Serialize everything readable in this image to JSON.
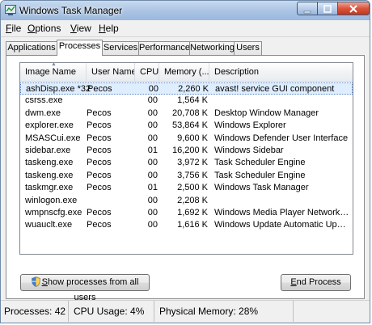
{
  "window": {
    "title": "Windows Task Manager"
  },
  "menu": [
    {
      "label": "File",
      "key": "F",
      "rest": "ile"
    },
    {
      "label": "Options",
      "key": "O",
      "rest": "ptions"
    },
    {
      "label": "View",
      "key": "V",
      "rest": "iew"
    },
    {
      "label": "Help",
      "key": "H",
      "rest": "elp"
    }
  ],
  "tabs": [
    "Applications",
    "Processes",
    "Services",
    "Performance",
    "Networking",
    "Users"
  ],
  "active_tab": "Processes",
  "columns": [
    "Image Name",
    "User Name",
    "CPU",
    "Memory (...",
    "Description"
  ],
  "rows": [
    {
      "name": "ashDisp.exe *32",
      "user": "Pecos",
      "cpu": "00",
      "mem": "2,260 K",
      "desc": "avast! service GUI component",
      "selected": true
    },
    {
      "name": "csrss.exe",
      "user": "",
      "cpu": "00",
      "mem": "1,564 K",
      "desc": ""
    },
    {
      "name": "dwm.exe",
      "user": "Pecos",
      "cpu": "00",
      "mem": "20,708 K",
      "desc": "Desktop Window Manager"
    },
    {
      "name": "explorer.exe",
      "user": "Pecos",
      "cpu": "00",
      "mem": "53,864 K",
      "desc": "Windows Explorer"
    },
    {
      "name": "MSASCui.exe",
      "user": "Pecos",
      "cpu": "00",
      "mem": "9,600 K",
      "desc": "Windows Defender User Interface"
    },
    {
      "name": "sidebar.exe",
      "user": "Pecos",
      "cpu": "01",
      "mem": "16,200 K",
      "desc": "Windows Sidebar"
    },
    {
      "name": "taskeng.exe",
      "user": "Pecos",
      "cpu": "00",
      "mem": "3,972 K",
      "desc": "Task Scheduler Engine"
    },
    {
      "name": "taskeng.exe",
      "user": "Pecos",
      "cpu": "00",
      "mem": "3,756 K",
      "desc": "Task Scheduler Engine"
    },
    {
      "name": "taskmgr.exe",
      "user": "Pecos",
      "cpu": "01",
      "mem": "2,500 K",
      "desc": "Windows Task Manager"
    },
    {
      "name": "winlogon.exe",
      "user": "",
      "cpu": "00",
      "mem": "2,208 K",
      "desc": ""
    },
    {
      "name": "wmpnscfg.exe",
      "user": "Pecos",
      "cpu": "00",
      "mem": "1,692 K",
      "desc": "Windows Media Player Network Shari..."
    },
    {
      "name": "wuauclt.exe",
      "user": "Pecos",
      "cpu": "00",
      "mem": "1,616 K",
      "desc": "Windows Update Automatic Updates"
    }
  ],
  "buttons": {
    "show_all": {
      "key": "S",
      "rest": "how processes from all users"
    },
    "end_process": {
      "key": "E",
      "rest": "nd Process"
    }
  },
  "status": {
    "processes": "Processes: 42",
    "cpu": "CPU Usage: 4%",
    "memory": "Physical Memory: 28%"
  }
}
